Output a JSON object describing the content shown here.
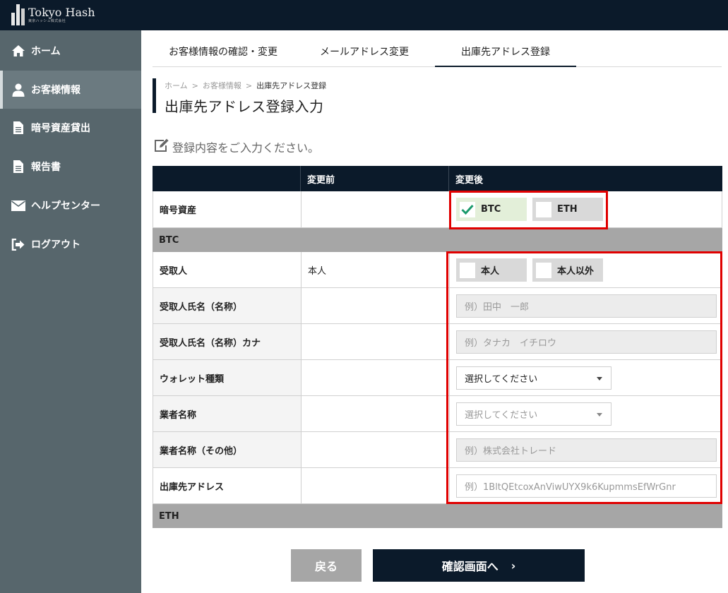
{
  "brand": {
    "name": "Tokyo Hash",
    "sub": "東京ハッシュ株式会社"
  },
  "sidebar": {
    "items": [
      {
        "label": "ホーム",
        "icon": "home-icon",
        "active": false
      },
      {
        "label": "お客様情報",
        "icon": "user-icon",
        "active": true
      },
      {
        "label": "暗号資産貸出",
        "icon": "document-icon",
        "active": false
      },
      {
        "label": "報告書",
        "icon": "document-icon",
        "active": false
      },
      {
        "label": "ヘルプセンター",
        "icon": "envelope-icon",
        "active": false
      },
      {
        "label": "ログアウト",
        "icon": "logout-icon",
        "active": false
      }
    ]
  },
  "tabs": [
    {
      "label": "お客様情報の確認・変更",
      "active": false
    },
    {
      "label": "メールアドレス変更",
      "active": false
    },
    {
      "label": "出庫先アドレス登録",
      "active": true
    }
  ],
  "breadcrumb": {
    "home": "ホーム",
    "sep": ">",
    "parent": "お客様情報",
    "current": "出庫先アドレス登録"
  },
  "page_title": "出庫先アドレス登録入力",
  "instruction": "登録内容をご入力ください。",
  "table": {
    "headers": [
      "",
      "変更前",
      "変更後"
    ],
    "asset_row": {
      "label": "暗号資産",
      "before": "",
      "options": [
        {
          "label": "BTC",
          "checked": true
        },
        {
          "label": "ETH",
          "checked": false
        }
      ]
    },
    "btc_section": "BTC",
    "recipient": {
      "label": "受取人",
      "before": "本人",
      "options": [
        {
          "label": "本人",
          "checked": false
        },
        {
          "label": "本人以外",
          "checked": false
        }
      ]
    },
    "recipient_name": {
      "label": "受取人氏名（名称）",
      "placeholder": "例）田中　一郎"
    },
    "recipient_kana": {
      "label": "受取人氏名（名称）カナ",
      "placeholder": "例）タナカ　イチロウ"
    },
    "wallet_type": {
      "label": "ウォレット種類",
      "value": "選択してください"
    },
    "provider": {
      "label": "業者名称",
      "value": "選択してください"
    },
    "provider_other": {
      "label": "業者名称（その他）",
      "placeholder": "例）株式会社トレード"
    },
    "address": {
      "label": "出庫先アドレス",
      "placeholder": "例）1BltQEtcoxAnViwUYX9k6KupmmsEfWrGnr"
    },
    "eth_section": "ETH"
  },
  "buttons": {
    "back": "戻る",
    "next": "確認画面へ",
    "next_chevron": "›"
  },
  "colors": {
    "navy": "#0b1a2a",
    "sidebar": "#57666c",
    "highlight": "#e00000",
    "check": "#1a9a6c"
  }
}
